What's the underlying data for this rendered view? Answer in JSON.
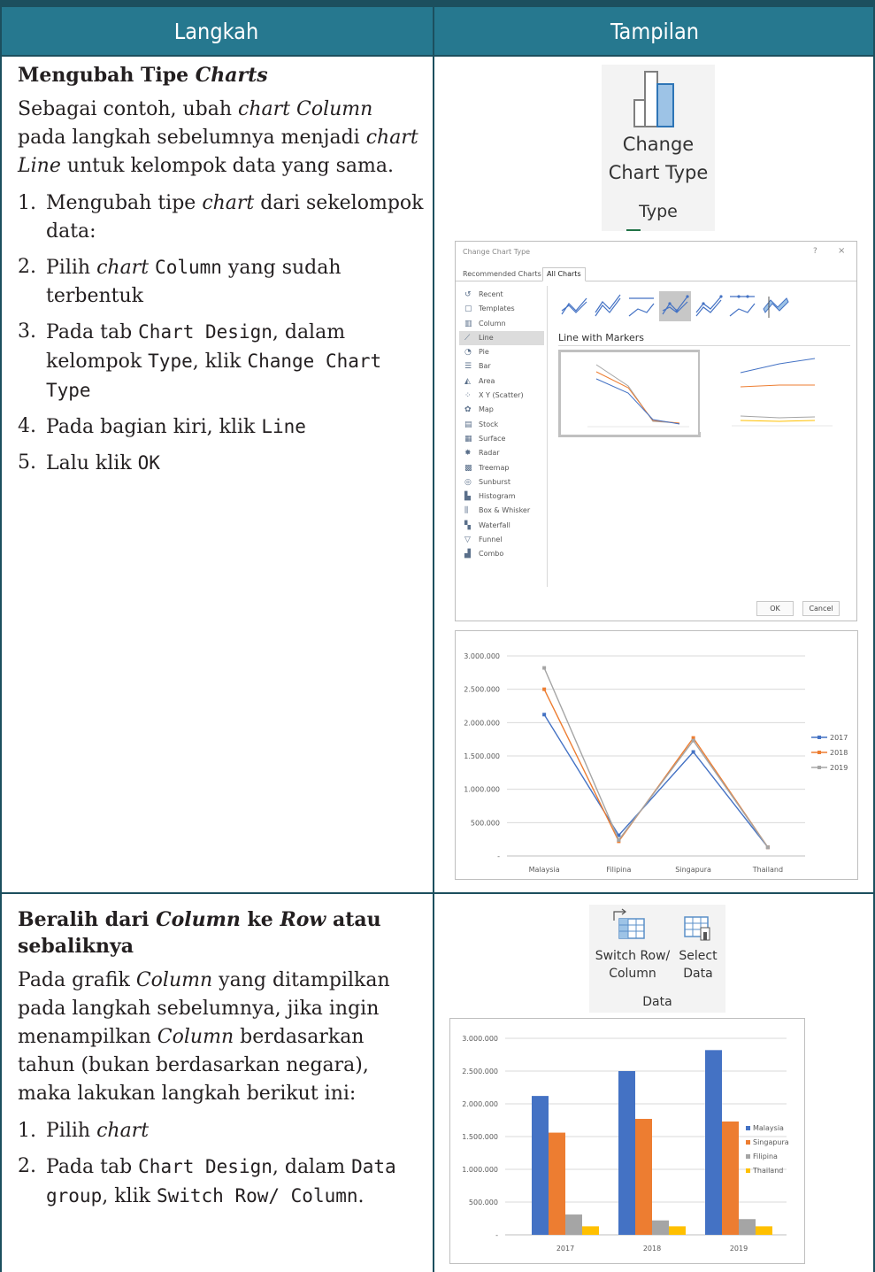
{
  "header": {
    "col1": "Langkah",
    "col2": "Tampilan"
  },
  "section1": {
    "title_plain": "Mengubah Tipe ",
    "title_italic": "Charts",
    "intro": {
      "t1": "Sebagai contoh, ubah ",
      "i1": "chart Column",
      "t2": " pada langkah sebelumnya menjadi ",
      "i2": "chart Line",
      "t3": " untuk kelompok data yang sama."
    },
    "steps": [
      {
        "num": "1.",
        "a": "Mengubah tipe ",
        "i": "chart",
        "b": " dari sekelompok data:"
      },
      {
        "num": "2.",
        "a": "Pilih ",
        "i": "chart",
        "b": " ",
        "code": "Column",
        "c": " yang sudah terbentuk"
      },
      {
        "num": "3.",
        "a": "Pada tab ",
        "code1": "Chart Design",
        "b": ", dalam kelompok ",
        "code2": "Type",
        "c": ", klik ",
        "code3": "Change Chart Type"
      },
      {
        "num": "4.",
        "a": "Pada bagian kiri, klik ",
        "code": "Line"
      },
      {
        "num": "5.",
        "a": "Lalu klik ",
        "code": "OK"
      }
    ],
    "ribbon": {
      "line1": "Change",
      "line2": "Chart Type",
      "group": "Type"
    },
    "dialog": {
      "title": "Change Chart Type",
      "help": "?",
      "close": "×",
      "tabs": [
        "Recommended Charts",
        "All Charts"
      ],
      "categories": [
        {
          "label": "Recent",
          "icon": "↺"
        },
        {
          "label": "Templates",
          "icon": "▢"
        },
        {
          "label": "Column",
          "icon": "▥"
        },
        {
          "label": "Line",
          "icon": "⟋"
        },
        {
          "label": "Pie",
          "icon": "◔"
        },
        {
          "label": "Bar",
          "icon": "☰"
        },
        {
          "label": "Area",
          "icon": "◭"
        },
        {
          "label": "X Y (Scatter)",
          "icon": "⁘"
        },
        {
          "label": "Map",
          "icon": "✿"
        },
        {
          "label": "Stock",
          "icon": "▤"
        },
        {
          "label": "Surface",
          "icon": "▦"
        },
        {
          "label": "Radar",
          "icon": "✸"
        },
        {
          "label": "Treemap",
          "icon": "▩"
        },
        {
          "label": "Sunburst",
          "icon": "◎"
        },
        {
          "label": "Histogram",
          "icon": "▙"
        },
        {
          "label": "Box & Whisker",
          "icon": "⫼"
        },
        {
          "label": "Waterfall",
          "icon": "▚"
        },
        {
          "label": "Funnel",
          "icon": "▽"
        },
        {
          "label": "Combo",
          "icon": "▟"
        }
      ],
      "selected_category": "Line",
      "subtype_title": "Line with Markers",
      "ok": "OK",
      "cancel": "Cancel"
    }
  },
  "section2": {
    "title": {
      "t1": "Beralih dari ",
      "i1": "Column",
      "t2": " ke ",
      "i2": "Row",
      "t3": " atau sebaliknya"
    },
    "intro": {
      "t1": "Pada grafik ",
      "i1": "Column",
      "t2": " yang ditampilkan pada langkah sebelumnya, jika ingin menampilkan ",
      "i2": "Column",
      "t3": " berdasarkan tahun (bukan berdasarkan negara), maka lakukan langkah berikut ini:"
    },
    "steps": [
      {
        "num": "1.",
        "a": "Pilih ",
        "i": "chart"
      },
      {
        "num": "2.",
        "a": "Pada tab ",
        "code1": "Chart Design",
        "b": ", dalam ",
        "code2": "Data group",
        "c": ", klik ",
        "code3": "Switch Row/ Column",
        "d": "."
      }
    ],
    "ribbon": {
      "switch1": "Switch Row/",
      "switch2": "Column",
      "select1": "Select",
      "select2": "Data",
      "group": "Data"
    }
  },
  "colors": {
    "header_bg": "#26788f",
    "border": "#1c4f5e",
    "blue": "#4472c4",
    "orange": "#ed7d31",
    "gray": "#a5a5a5",
    "yellow": "#ffc000"
  },
  "chart_data": [
    {
      "type": "line",
      "categories": [
        "Malaysia",
        "Filipina",
        "Singapura",
        "Thailand"
      ],
      "series": [
        {
          "name": "2017",
          "values": [
            2120000,
            310000,
            1560000,
            130000
          ],
          "color": "#4472c4"
        },
        {
          "name": "2018",
          "values": [
            2500000,
            220000,
            1770000,
            130000
          ],
          "color": "#ed7d31"
        },
        {
          "name": "2019",
          "values": [
            2820000,
            240000,
            1730000,
            130000
          ],
          "color": "#a5a5a5"
        }
      ],
      "yticks": [
        "-",
        "500.000",
        "1.000.000",
        "1.500.000",
        "2.000.000",
        "2.500.000",
        "3.000.000"
      ],
      "ylim": [
        0,
        3000000
      ],
      "legend": "right"
    },
    {
      "type": "bar",
      "categories": [
        "2017",
        "2018",
        "2019"
      ],
      "series": [
        {
          "name": "Malaysia",
          "values": [
            2120000,
            2500000,
            2820000
          ],
          "color": "#4472c4"
        },
        {
          "name": "Singapura",
          "values": [
            1560000,
            1770000,
            1730000
          ],
          "color": "#ed7d31"
        },
        {
          "name": "Filipina",
          "values": [
            310000,
            220000,
            240000
          ],
          "color": "#a5a5a5"
        },
        {
          "name": "Thailand",
          "values": [
            130000,
            130000,
            130000
          ],
          "color": "#ffc000"
        }
      ],
      "yticks": [
        "-",
        "500.000",
        "1.000.000",
        "1.500.000",
        "2.000.000",
        "2.500.000",
        "3.000.000"
      ],
      "ylim": [
        0,
        3000000
      ],
      "legend": "right"
    }
  ]
}
